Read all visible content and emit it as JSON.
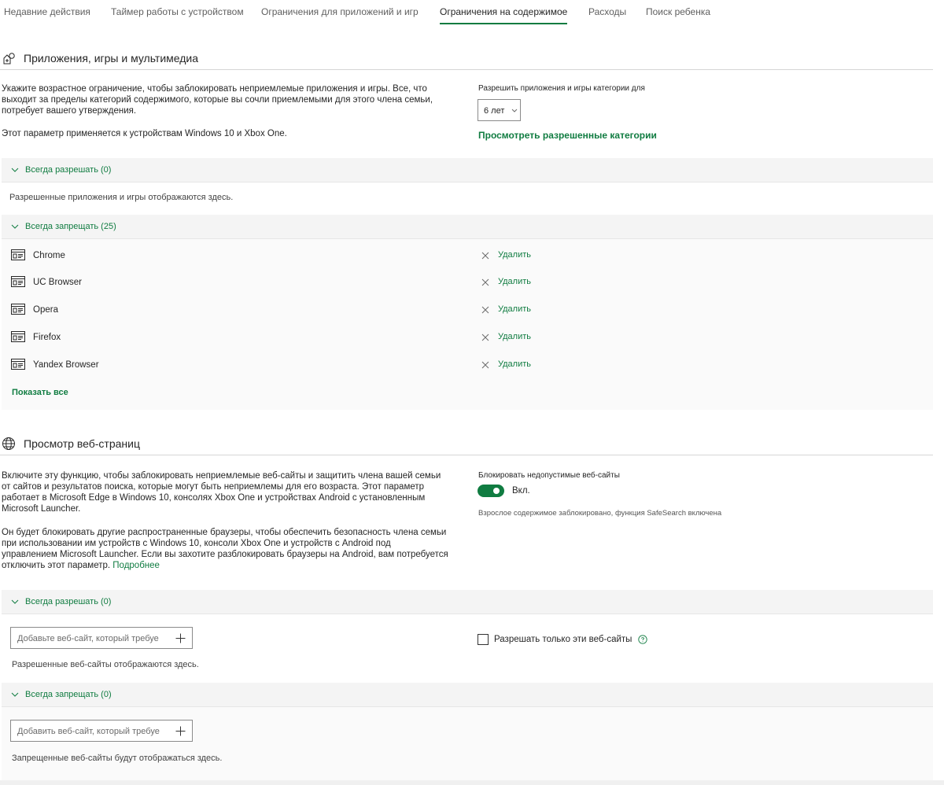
{
  "tabs": [
    {
      "label": "Недавние действия"
    },
    {
      "label": "Таймер работы с устройством"
    },
    {
      "label": "Ограничения для приложений и игр"
    },
    {
      "label": "Ограничения на содержимое"
    },
    {
      "label": "Расходы"
    },
    {
      "label": "Поиск ребенка"
    }
  ],
  "active_tab": "Ограничения на содержимое",
  "apps": {
    "title": "Приложения, игры и мультимедиа",
    "description_line1": "Укажите возрастное ограничение, чтобы заблокировать неприемлемые приложения и игры. Все, что",
    "description_line2": "выходит за пределы категорий содержимого, которые вы сочли приемлемыми для этого члена семьи,",
    "description_line3": "потребует вашего утверждения.",
    "note": "Этот параметр применяется к устройствам Windows 10 и Xbox One.",
    "age_label": "Разрешить приложения и игры категории для",
    "age_value": "6 лет",
    "view_categories_link": "Просмотреть разрешенные категории",
    "always_allow": {
      "title": "Всегда разрешать (0)",
      "empty_text": "Разрешенные приложения и игры отображаются здесь."
    },
    "always_block": {
      "title": "Всегда запрещать (25)",
      "items": [
        {
          "name": "Chrome",
          "action": "Удалить"
        },
        {
          "name": "UC Browser",
          "action": "Удалить"
        },
        {
          "name": "Opera",
          "action": "Удалить"
        },
        {
          "name": "Firefox",
          "action": "Удалить"
        },
        {
          "name": "Yandex Browser",
          "action": "Удалить"
        }
      ],
      "show_all": "Показать все"
    }
  },
  "web": {
    "title": "Просмотр веб-страниц",
    "description_lines": [
      "Включите эту функцию, чтобы заблокировать неприемлемые веб-сайты и защитить члена вашей семьи",
      "от сайтов и результатов поиска, которые могут быть неприемлемы для его возраста. Этот параметр",
      "работает в Microsoft Edge в Windows 10, консолях Xbox One и устройствах Android с установленным",
      "Microsoft Launcher."
    ],
    "description2_lines": [
      "Он будет блокировать другие распространенные браузеры, чтобы обеспечить безопасность члена семьи",
      "при использовании им устройств с Windows 10, консоли Xbox One и устройств с Android под",
      "управлением Microsoft Launcher. Если вы захотите разблокировать браузеры на Android, вам потребуется"
    ],
    "description2_last": "отключить этот параметр.",
    "more_link": "Подробнее",
    "block_label": "Блокировать недопустимые веб-сайты",
    "toggle_state": "Вкл.",
    "toggle_on": true,
    "status_text": "Взрослое содержимое заблокировано, функция SafeSearch включена",
    "always_allow": {
      "title": "Всегда разрешать (0)",
      "input_placeholder": "Добавьте веб-сайт, который требуе",
      "empty_text": "Разрешенные веб-сайты отображаются здесь.",
      "only_these_label": "Разрешать только эти веб-сайты"
    },
    "always_block": {
      "title": "Всегда запрещать (0)",
      "input_placeholder": "Добавить веб-сайт, который требуе",
      "empty_text": "Запрещенные веб-сайты будут отображаться здесь."
    }
  },
  "colors": {
    "accent": "#107c41",
    "panel_header": "#f4f4f4",
    "panel_body": "#fafafa"
  },
  "icons": {
    "apps_section": "apps-games-media-icon",
    "web_section": "globe-icon",
    "app_item": "app-window-icon",
    "remove": "close-icon",
    "collapse": "chevron-down-icon",
    "add": "plus-icon",
    "help": "help-circle-icon"
  }
}
